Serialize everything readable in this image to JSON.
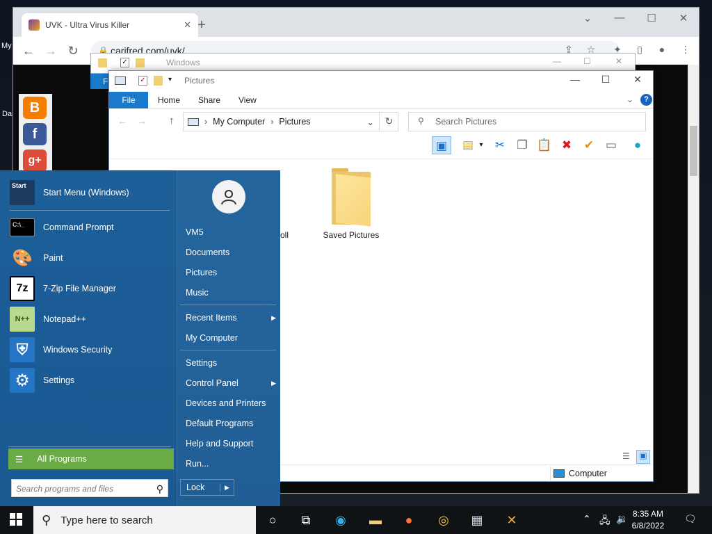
{
  "desktop": {
    "label_1": "My",
    "label_2": "Da"
  },
  "browser": {
    "tab_title": "UVK - Ultra Virus Killer",
    "tab_close": "✕",
    "new_tab": "+",
    "minimize": "—",
    "maximize": "☐",
    "close": "✕",
    "url": "carifred.com/uvk/",
    "nav": {
      "back": "←",
      "forward": "→",
      "reload": "↻"
    }
  },
  "explorer_back": {
    "title": "Windows",
    "file_tab": "F"
  },
  "explorer": {
    "title": "Pictures",
    "ribbon_tabs": [
      "File",
      "Home",
      "Share",
      "View"
    ],
    "help": "?",
    "address": {
      "root": "My Computer",
      "sep": "›",
      "current": "Pictures"
    },
    "search_placeholder": "Search Pictures",
    "folders": [
      {
        "label": "oll"
      },
      {
        "label": "Saved Pictures"
      }
    ],
    "status_computer": "Computer"
  },
  "start_menu": {
    "pinned": [
      {
        "label": "Start Menu (Windows)",
        "icon": "start-menu-icon",
        "icon_text": "Start"
      },
      {
        "label": "Command Prompt",
        "icon": "command-prompt-icon",
        "icon_text": "C:\\_"
      },
      {
        "label": "Paint",
        "icon": "paint-icon",
        "icon_text": "🎨"
      },
      {
        "label": "7-Zip File Manager",
        "icon": "seven-zip-icon",
        "icon_text": "7z"
      },
      {
        "label": "Notepad++",
        "icon": "notepad-plus-icon",
        "icon_text": "N++"
      },
      {
        "label": "Windows Security",
        "icon": "shield-icon",
        "icon_text": "⛨"
      },
      {
        "label": "Settings",
        "icon": "gear-icon",
        "icon_text": "⚙"
      }
    ],
    "all_programs": "All Programs",
    "search_placeholder": "Search programs and files",
    "right_items": [
      {
        "label": "VM5",
        "submenu": false
      },
      {
        "label": "Documents",
        "submenu": false
      },
      {
        "label": "Pictures",
        "submenu": false
      },
      {
        "label": "Music",
        "submenu": false
      },
      {
        "label": "Recent Items",
        "submenu": true
      },
      {
        "label": "My Computer",
        "submenu": false
      },
      {
        "label": "Settings",
        "submenu": false
      },
      {
        "label": "Control Panel",
        "submenu": true
      },
      {
        "label": "Devices and Printers",
        "submenu": false
      },
      {
        "label": "Default Programs",
        "submenu": false
      },
      {
        "label": "Help and Support",
        "submenu": false
      },
      {
        "label": "Run...",
        "submenu": false
      }
    ],
    "submenu_arrow": "▶",
    "lock": "Lock",
    "lock_arrow": "▶"
  },
  "taskbar": {
    "search_placeholder": "Type here to search",
    "time": "8:35 AM",
    "date": "6/8/2022"
  },
  "colors": {
    "start_menu_bg": "#1b5c96",
    "all_programs_bg": "#6aab45",
    "file_tab_bg": "#1979ca",
    "taskbar_bg": "#101316"
  }
}
